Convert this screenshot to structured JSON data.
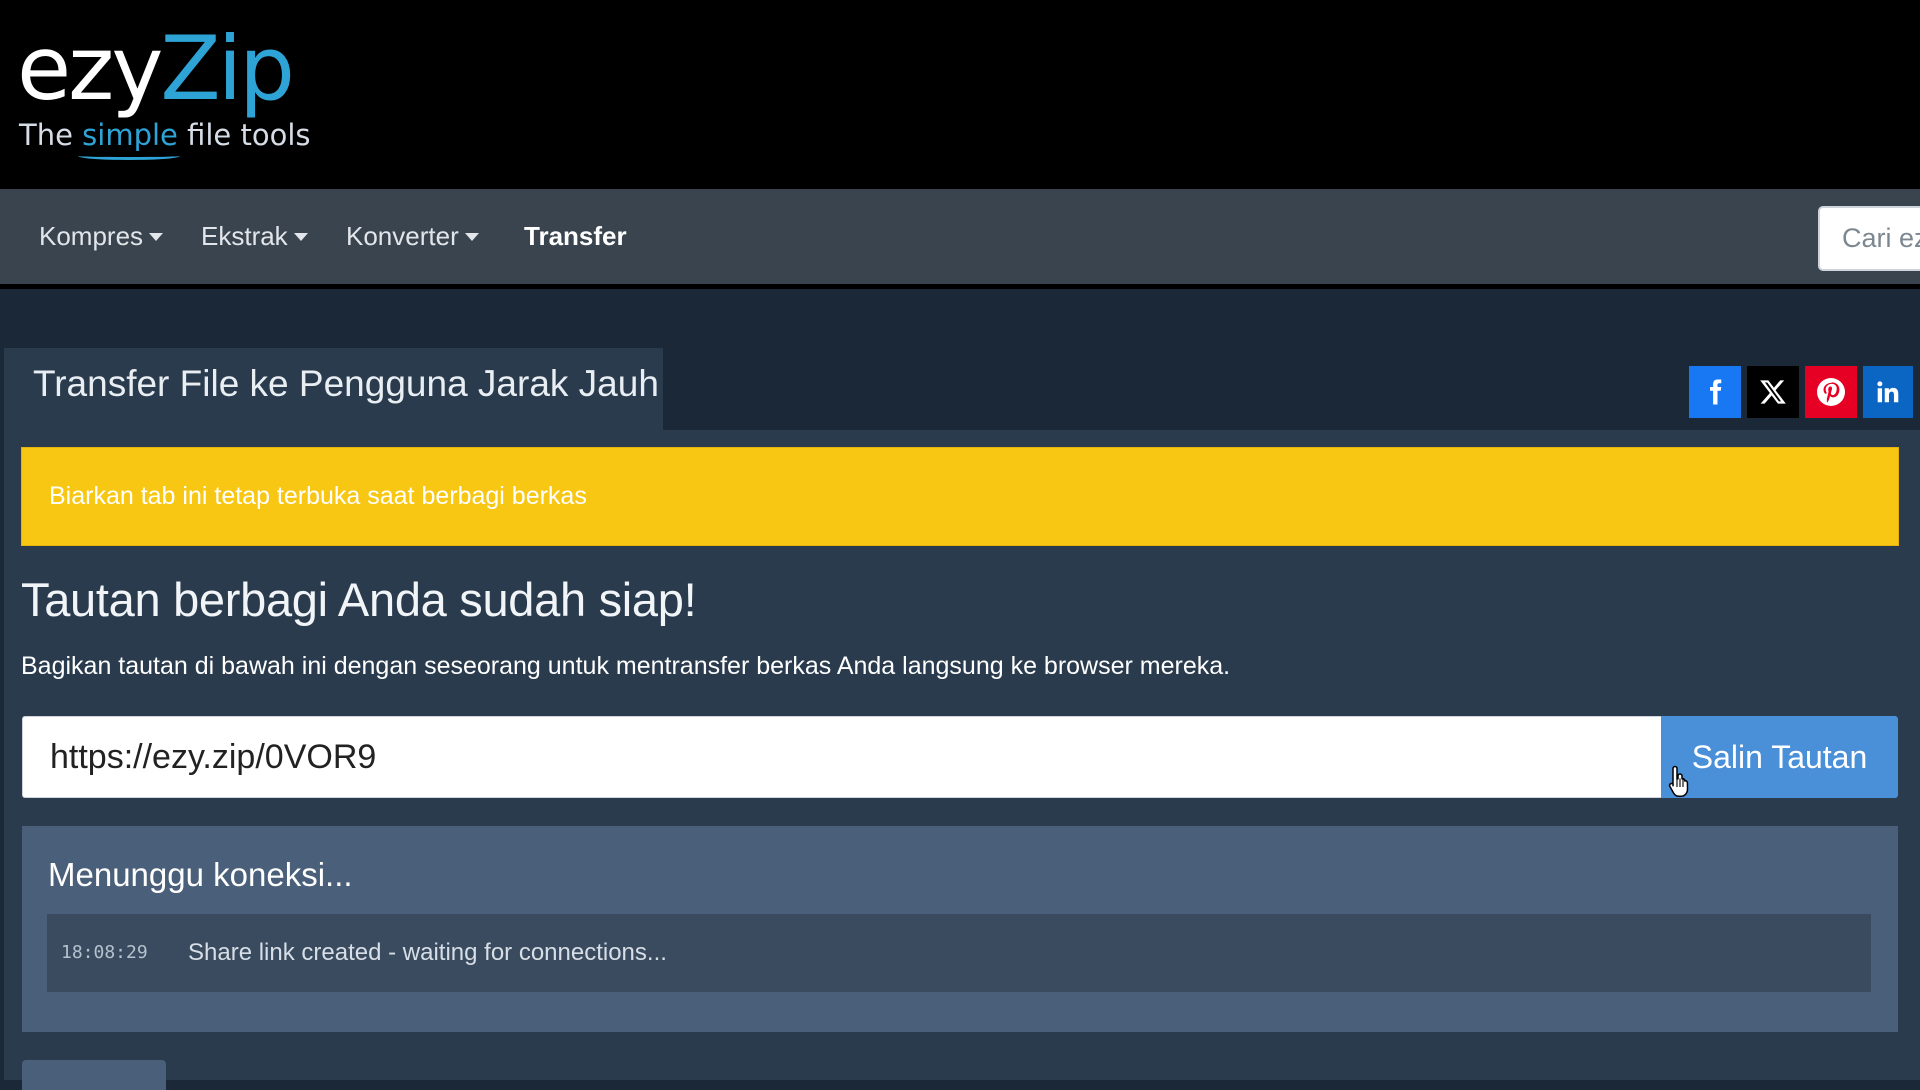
{
  "logo": {
    "word_white": "ezy",
    "word_blue": "Zip",
    "tagline_before": "The ",
    "tagline_highlight": "simple",
    "tagline_after": " file tools"
  },
  "nav": {
    "items": [
      {
        "label": "Kompres",
        "dropdown": true
      },
      {
        "label": "Ekstrak",
        "dropdown": true
      },
      {
        "label": "Konverter",
        "dropdown": true
      },
      {
        "label": "Transfer",
        "dropdown": false,
        "active": true
      }
    ],
    "search_placeholder": "Cari ez"
  },
  "tab": {
    "title": "Transfer File ke Pengguna Jarak Jauh"
  },
  "social": [
    {
      "name": "facebook",
      "icon": "facebook-icon",
      "color": "#1877f2"
    },
    {
      "name": "x",
      "icon": "x-icon",
      "color": "#000000"
    },
    {
      "name": "pinterest",
      "icon": "pinterest-icon",
      "color": "#e60023"
    },
    {
      "name": "linkedin",
      "icon": "linkedin-icon",
      "color": "#0a66c2"
    }
  ],
  "alert": {
    "text": "Biarkan tab ini tetap terbuka saat berbagi berkas",
    "color": "#f8c713"
  },
  "share": {
    "heading": "Tautan berbagi Anda sudah siap!",
    "description": "Bagikan tautan di bawah ini dengan seseorang untuk mentransfer berkas Anda langsung ke browser mereka.",
    "link": "https://ezy.zip/0VOR9",
    "copy_label": "Salin Tautan"
  },
  "status": {
    "title": "Menunggu koneksi...",
    "log": [
      {
        "time": "18:08:29",
        "message": "Share link created - waiting for connections..."
      }
    ]
  },
  "colors": {
    "header_bg": "#000000",
    "nav_bg": "#39444f",
    "page_bg": "#1b2838",
    "panel_bg": "#2a3b4e",
    "accent": "#2ea3d6",
    "button": "#4a90d9"
  }
}
